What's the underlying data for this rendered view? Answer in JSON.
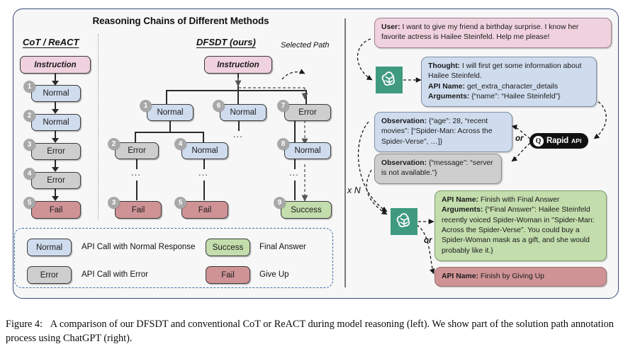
{
  "figure": {
    "caption_label": "Figure 4:",
    "caption_text": "A comparison of our DFSDT and conventional CoT or ReACT during model reasoning (left). We show part of the solution path annotation process using ChatGPT (right)."
  },
  "left_panel": {
    "title": "Reasoning Chains of Different Methods",
    "columns": [
      {
        "heading": "CoT / ReACT"
      },
      {
        "heading": "DFSDT (ours)"
      }
    ],
    "selected_path_label": "Selected Path",
    "cot_chain": {
      "root": "Instruction",
      "nodes": [
        {
          "badge": "1",
          "label": "Normal"
        },
        {
          "badge": "2",
          "label": "Normal"
        },
        {
          "badge": "3",
          "label": "Error"
        },
        {
          "badge": "4",
          "label": "Error"
        },
        {
          "badge": "5",
          "label": "Fail"
        }
      ]
    },
    "dfsdt_tree": {
      "root": "Instruction",
      "nodes": [
        {
          "badge": "1",
          "label": "Normal"
        },
        {
          "badge": "6",
          "label": "Normal"
        },
        {
          "badge": "7",
          "label": "Error"
        },
        {
          "badge": "2",
          "label": "Error"
        },
        {
          "badge": "4",
          "label": "Normal"
        },
        {
          "badge": "8",
          "label": "Normal"
        },
        {
          "badge": "3",
          "label": "Fail"
        },
        {
          "badge": "5",
          "label": "Fail"
        },
        {
          "badge": "9",
          "label": "Success"
        }
      ],
      "ellipsis": "..."
    },
    "legend": {
      "items": [
        {
          "chip": "Normal",
          "text": "API Call with Normal Response"
        },
        {
          "chip": "Error",
          "text": "API Call with Error"
        },
        {
          "chip": "Success",
          "text": "Final Answer"
        },
        {
          "chip": "Fail",
          "text": "Give Up"
        }
      ]
    }
  },
  "right_panel": {
    "user_message": {
      "speaker": "User:",
      "text": " I want to give my friend a birthday surprise. I know her favorite actress is Hailee Steinfeld. Help me please!"
    },
    "thought_bubble": {
      "thought_label": "Thought:",
      "thought_text": " I will first get some information about Hailee Steinfeld.",
      "api_label": "API Name:",
      "api_value": " get_extra_character_details",
      "args_label": "Arguments:",
      "args_value": " {“name”: “Hailee Steinfeld”}"
    },
    "observation_ok": {
      "label": "Observation:",
      "text": " {“age”: 28, “recent movies”: [“Spider-Man: Across the Spider-Verse”, …]}"
    },
    "observation_error": {
      "label": "Observation:",
      "text": " {“message”: “server is not available.”}"
    },
    "final_answer": {
      "api_label": "API Name:",
      "api_value": "  Finish with Final Answer",
      "args_label": "Arguments:",
      "args_value": " {“Final Answer”: Hailee Steinfeld recently voiced Spider-Woman in \"Spider-Man: Across the Spider-Verse”.  You could buy a Spider-Woman mask as a gift, and she would probably like it.}"
    },
    "give_up": {
      "api_label": "API Name:",
      "api_value": "  Finish by Giving Up"
    },
    "or_labels": [
      "or",
      "or"
    ],
    "repeat_label": "x N",
    "rapidapi": {
      "mark": "Q",
      "name": "Rapid",
      "suffix": "API"
    },
    "chatgpt_icon_name": "chatgpt-logo"
  },
  "colors": {
    "normal": "#cfdcee",
    "error": "#cecece",
    "fail": "#cf9396",
    "success": "#c3ddad",
    "instruction": "#f0d2de",
    "frame_border": "#3b4a7a",
    "legend_border": "#3b6fa8",
    "gpt_green": "#3f9a80",
    "rapidapi_black": "#111111"
  }
}
